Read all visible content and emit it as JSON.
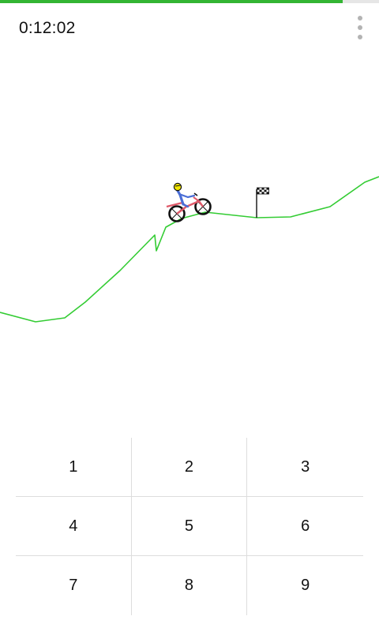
{
  "status": {
    "timer": "0:12:02",
    "progress": 0.905
  },
  "menu": {
    "icon": "overflow-menu-icon"
  },
  "colors": {
    "track": "#33cc33",
    "progress": "#33b533",
    "rider_helmet": "#f2e600",
    "rider_body": "#4a6ed6",
    "bike_frame": "#e05a6a"
  },
  "keypad": {
    "keys": [
      "1",
      "2",
      "3",
      "4",
      "5",
      "6",
      "7",
      "8",
      "9"
    ]
  }
}
